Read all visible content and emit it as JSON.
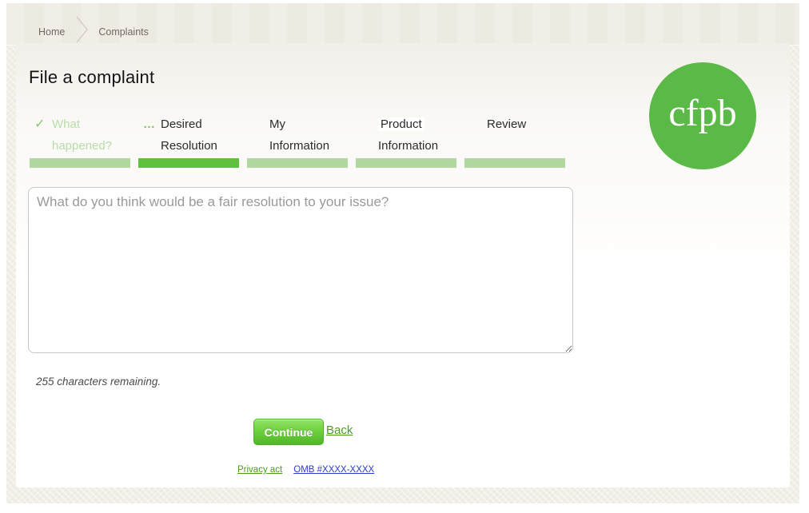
{
  "breadcrumb": {
    "home": "Home",
    "complaints": "Complaints"
  },
  "page": {
    "title": "File a complaint"
  },
  "logo": {
    "text": "cfpb"
  },
  "steps": [
    {
      "line1": "What",
      "line2": "happened?",
      "icon": "check-icon",
      "icon_glyph": "✓",
      "state": "completed"
    },
    {
      "line1": "Desired",
      "line2": "Resolution",
      "icon": "ellipsis-icon",
      "icon_glyph": "…",
      "state": "active"
    },
    {
      "line1": "My",
      "line2": "Information",
      "state": "upcoming"
    },
    {
      "line1": "Product",
      "line2": "Information",
      "state": "upcoming"
    },
    {
      "line1": "Review",
      "line2": "",
      "state": "upcoming"
    }
  ],
  "form": {
    "textarea_placeholder": "What do you think would be a fair resolution to your issue?",
    "textarea_value": "",
    "chars_remaining": "255 characters remaining."
  },
  "actions": {
    "continue_label": "Continue",
    "back_label": "Back"
  },
  "footer_links": {
    "privacy": "Privacy act",
    "omb": "OMB #XXXX-XXXX"
  },
  "colors": {
    "logo_green": "#5bba47",
    "active_bar_green": "#5fc13d",
    "inactive_bar_green": "#b0d79f",
    "completed_text_green": "#b9dcaa",
    "link_green": "#4a9e1f",
    "link_blue": "#2b3cc8",
    "header_beige": "#edeae2"
  }
}
